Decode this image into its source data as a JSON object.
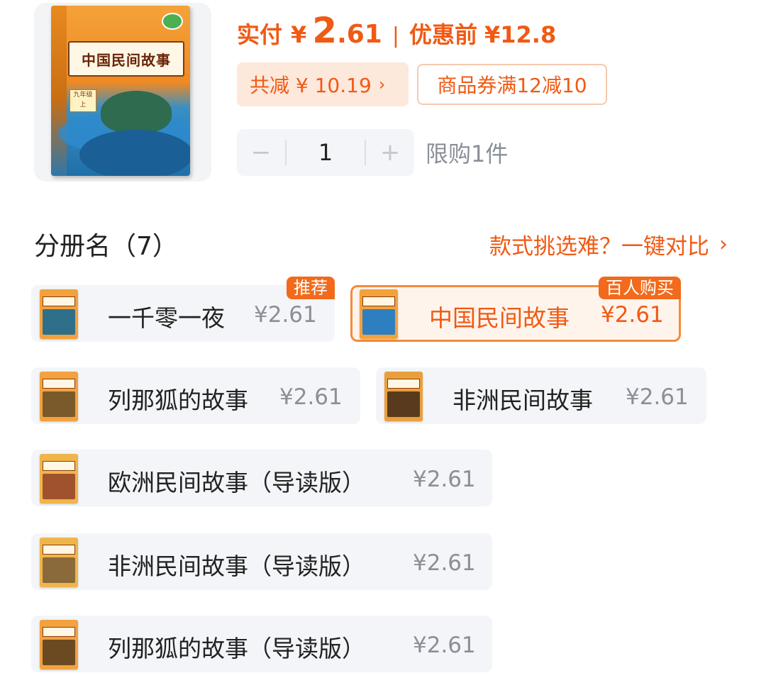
{
  "product": {
    "cover_title": "中国民间故事",
    "cover_grade": "九年级 上"
  },
  "pricing": {
    "paid_label": "实付",
    "currency": "¥",
    "paid_int": "2",
    "paid_dec": ".61",
    "separator": "|",
    "original_label": "优惠前",
    "original_price": "¥12.8",
    "discount_text": "共减 ¥ 10.19",
    "coupon_text": "商品券满12减10"
  },
  "quantity": {
    "minus": "−",
    "value": "1",
    "plus": "+",
    "limit_text": "限购1件"
  },
  "variants_section": {
    "title": "分册名（7）",
    "compare_link": "款式挑选难？一键对比",
    "items": [
      {
        "name": "一千零一夜",
        "price": "¥2.61",
        "badge": "推荐"
      },
      {
        "name": "中国民间故事",
        "price": "¥2.61",
        "badge": "百人购买",
        "selected": true
      },
      {
        "name": "列那狐的故事",
        "price": "¥2.61"
      },
      {
        "name": "非洲民间故事",
        "price": "¥2.61"
      },
      {
        "name": "欧洲民间故事（导读版）",
        "price": "¥2.61"
      },
      {
        "name": "非洲民间故事（导读版）",
        "price": "¥2.61"
      },
      {
        "name": "列那狐的故事（导读版）",
        "price": "¥2.61"
      }
    ]
  },
  "icons": {
    "chevron": "chevron-right-icon"
  },
  "colors": {
    "accent": "#f05a14",
    "badge_bg": "#f26a1b",
    "selected_border": "#f58a3c",
    "chip_bg": "#f3f5f8",
    "muted_text": "#8a8f98"
  }
}
